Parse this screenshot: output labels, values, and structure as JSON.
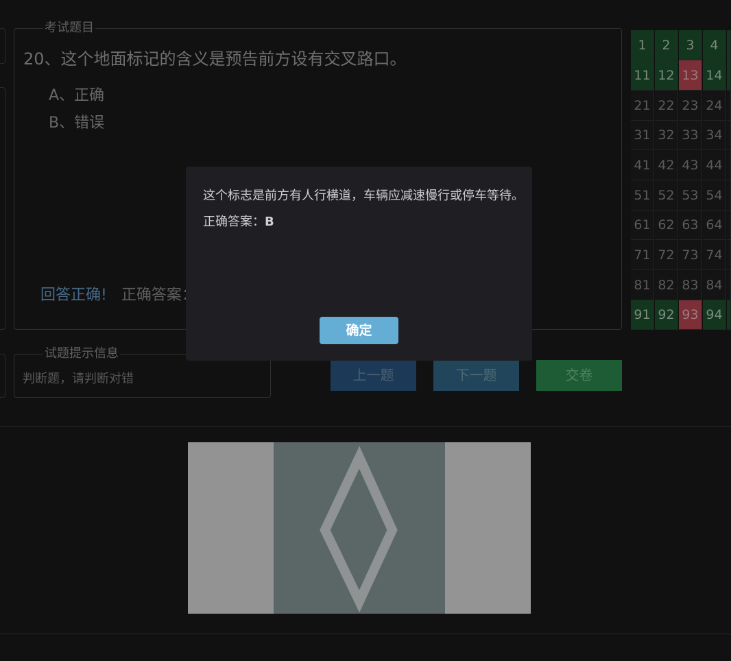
{
  "exam": {
    "legend": "考试题目",
    "question": "20、这个地面标记的含义是预告前方设有交叉路口。",
    "options": [
      "A、正确",
      "B、错误"
    ],
    "feedback_result": "回答正确!",
    "feedback_answer_label": "正确答案："
  },
  "hint": {
    "legend": "试题提示信息",
    "text": "判断题，请判断对错"
  },
  "buttons": {
    "prev": "上一题",
    "next": "下一题",
    "submit": "交卷"
  },
  "grid": {
    "rows": [
      [
        {
          "n": "1",
          "s": "ok"
        },
        {
          "n": "2",
          "s": "ok"
        },
        {
          "n": "3",
          "s": "ok"
        },
        {
          "n": "4",
          "s": "ok"
        }
      ],
      [
        {
          "n": "11",
          "s": "ok"
        },
        {
          "n": "12",
          "s": "ok"
        },
        {
          "n": "13",
          "s": "wrong"
        },
        {
          "n": "14",
          "s": "ok"
        }
      ],
      [
        {
          "n": "21",
          "s": ""
        },
        {
          "n": "22",
          "s": ""
        },
        {
          "n": "23",
          "s": ""
        },
        {
          "n": "24",
          "s": ""
        }
      ],
      [
        {
          "n": "31",
          "s": ""
        },
        {
          "n": "32",
          "s": ""
        },
        {
          "n": "33",
          "s": ""
        },
        {
          "n": "34",
          "s": ""
        }
      ],
      [
        {
          "n": "41",
          "s": ""
        },
        {
          "n": "42",
          "s": ""
        },
        {
          "n": "43",
          "s": ""
        },
        {
          "n": "44",
          "s": ""
        }
      ],
      [
        {
          "n": "51",
          "s": ""
        },
        {
          "n": "52",
          "s": ""
        },
        {
          "n": "53",
          "s": ""
        },
        {
          "n": "54",
          "s": ""
        }
      ],
      [
        {
          "n": "61",
          "s": ""
        },
        {
          "n": "62",
          "s": ""
        },
        {
          "n": "63",
          "s": ""
        },
        {
          "n": "64",
          "s": ""
        }
      ],
      [
        {
          "n": "71",
          "s": ""
        },
        {
          "n": "72",
          "s": ""
        },
        {
          "n": "73",
          "s": ""
        },
        {
          "n": "74",
          "s": ""
        }
      ],
      [
        {
          "n": "81",
          "s": ""
        },
        {
          "n": "82",
          "s": ""
        },
        {
          "n": "83",
          "s": ""
        },
        {
          "n": "84",
          "s": ""
        }
      ],
      [
        {
          "n": "91",
          "s": "ok"
        },
        {
          "n": "92",
          "s": "ok"
        },
        {
          "n": "93",
          "s": "wrong"
        },
        {
          "n": "94",
          "s": "ok"
        }
      ]
    ]
  },
  "modal": {
    "message": "这个标志是前方有人行横道，车辆应减速慢行或停车等待。",
    "answer_label": "正确答案：",
    "answer_value": "B",
    "confirm": "确定"
  },
  "colors": {
    "background": "#111111",
    "correct_cell": "#13361f",
    "wrong_cell": "#7c2f37",
    "confirm_button": "#64aed6",
    "submit_button": "#1d5c34"
  }
}
